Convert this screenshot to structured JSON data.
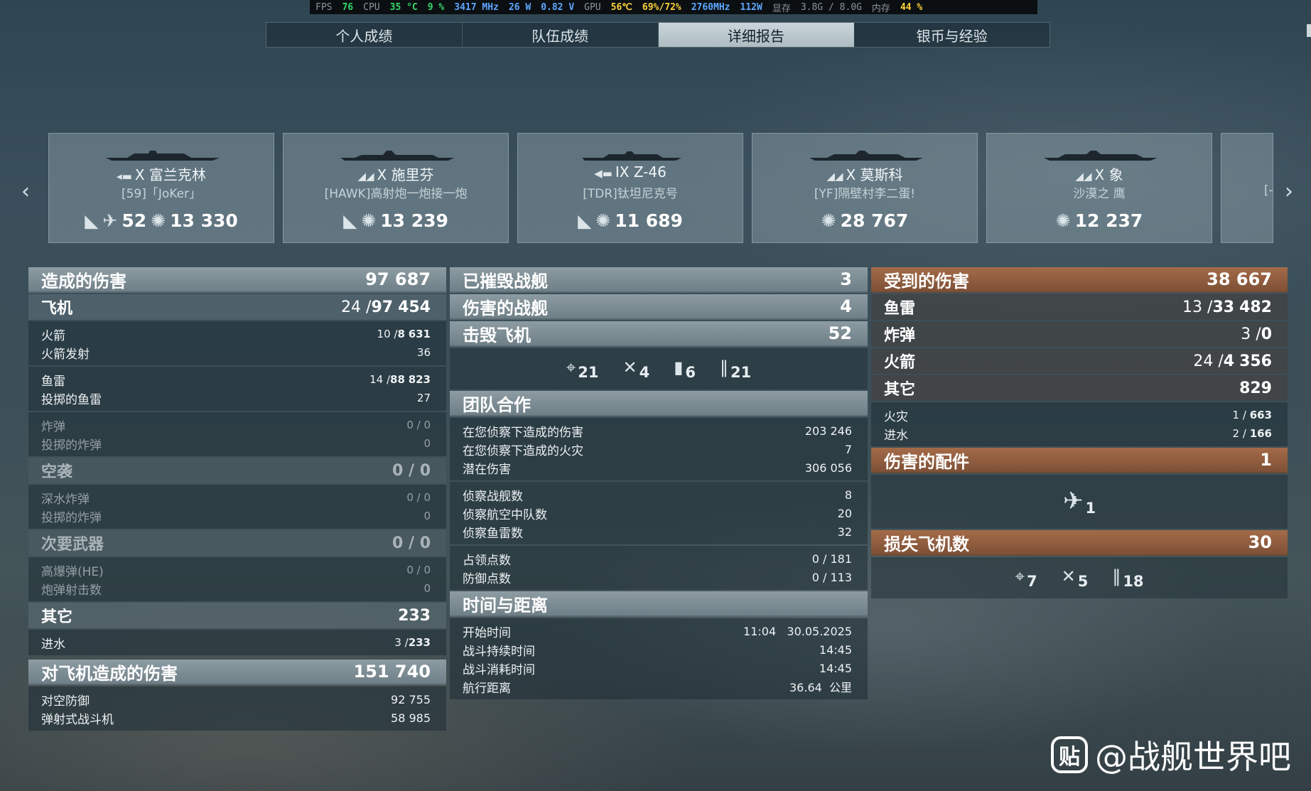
{
  "perf": {
    "fps_label": "FPS",
    "fps": "76",
    "cpu_label": "CPU",
    "cpu_temp": "35 °C",
    "cpu_load": "9 %",
    "cpu_freq": "3417 MHz",
    "cpu_power": "26 W",
    "cpu_volt": "0.82 V",
    "gpu_label": "GPU",
    "gpu_temp": "56℃",
    "gpu_load": "69%/72%",
    "gpu_freq": "2760MHz",
    "gpu_power": "112W",
    "vram_label": "显存",
    "vram": "3.8G / 8.0G",
    "ram_label": "内存",
    "ram": "44 %"
  },
  "tabs": [
    "个人成绩",
    "队伍成绩",
    "详细报告",
    "银币与经验"
  ],
  "ships": [
    {
      "tier": "X",
      "name": "富兰克林",
      "player": "[59]「JoKer」",
      "kills": "52",
      "damage": "13 330"
    },
    {
      "tier": "X",
      "name": "施里芬",
      "player": "[HAWK]高射炮一炮接一炮",
      "damage": "13 239"
    },
    {
      "tier": "IX",
      "name": "Z-46",
      "player": "[TDR]钛坦尼克号",
      "damage": "11 689"
    },
    {
      "tier": "X",
      "name": "莫斯科",
      "player": "[YF]隔壁村李二蛋!",
      "damage": "28 767"
    },
    {
      "tier": "X",
      "name": "象",
      "player": "沙漠之 鹰",
      "damage": "12 237"
    },
    {
      "player": "[-"
    }
  ],
  "left": {
    "damage_dealt": {
      "label": "造成的伤害",
      "value": "97 687"
    },
    "aircraft": {
      "label": "飞机",
      "hits": "24 /",
      "bold": "97",
      "value": "454"
    },
    "rockets": {
      "label": "火箭",
      "v1": "10 /",
      "v2": "8",
      "v3": "631"
    },
    "rockets_fired": {
      "label": "火箭发射",
      "value": "36"
    },
    "torpedoes": {
      "label": "鱼雷",
      "v1": "14 /",
      "v2": "88",
      "v3": "823"
    },
    "torpedoes_dropped": {
      "label": "投掷的鱼雷",
      "value": "27"
    },
    "bombs": {
      "label": "炸弹",
      "value": "0 / 0"
    },
    "bombs_dropped": {
      "label": "投掷的炸弹",
      "value": "0"
    },
    "airstrike": {
      "label": "空袭",
      "value": "0 / 0"
    },
    "depth_bombs": {
      "label": "深水炸弹",
      "value": "0 / 0"
    },
    "depth_dropped": {
      "label": "投掷的炸弹",
      "value": "0"
    },
    "secondary": {
      "label": "次要武器",
      "value": "0 / 0"
    },
    "he": {
      "label": "高爆弹(HE)",
      "value": "0 / 0"
    },
    "shells": {
      "label": "炮弹射击数",
      "value": "0"
    },
    "other": {
      "label": "其它",
      "value": "233"
    },
    "flooding": {
      "label": "进水",
      "v1": "3 /",
      "v2": "233"
    },
    "aa_damage": {
      "label": "对飞机造成的伤害",
      "value": "151 740"
    },
    "aa_defense": {
      "label": "对空防御",
      "value": "92 755"
    },
    "catapult": {
      "label": "弹射式战斗机",
      "value": "58 985"
    }
  },
  "middle": {
    "destroyed": {
      "label": "已摧毁战舰",
      "value": "3"
    },
    "damaged": {
      "label": "伤害的战舰",
      "value": "4"
    },
    "planes_shot": {
      "label": "击毁飞机",
      "value": "52"
    },
    "plane_icons": {
      "fighters": "21",
      "bombers": "4",
      "torpedo": "6",
      "rocket": "21"
    },
    "team": {
      "label": "团队合作"
    },
    "spot_damage": {
      "label": "在您侦察下造成的伤害",
      "value": "203 246"
    },
    "spot_fires": {
      "label": "在您侦察下造成的火灾",
      "value": "7"
    },
    "potential": {
      "label": "潜在伤害",
      "value": "306 056"
    },
    "spotted_ships": {
      "label": "侦察战舰数",
      "value": "8"
    },
    "spotted_squadrons": {
      "label": "侦察航空中队数",
      "value": "20"
    },
    "spotted_torps": {
      "label": "侦察鱼雷数",
      "value": "32"
    },
    "capture": {
      "label": "占领点数",
      "value": "0 / 181"
    },
    "defend": {
      "label": "防御点数",
      "value": "0 / 113"
    },
    "time": {
      "label": "时间与距离"
    },
    "start": {
      "label": "开始时间",
      "time": "11:04",
      "date": "30.05.2025"
    },
    "duration": {
      "label": "战斗持续时间",
      "value": "14:45"
    },
    "elapsed": {
      "label": "战斗消耗时间",
      "value": "14:45"
    },
    "distance": {
      "label": "航行距离",
      "value": "36.64",
      "unit": "公里"
    }
  },
  "right": {
    "received": {
      "label": "受到的伤害",
      "value": "38 667"
    },
    "torpedo": {
      "label": "鱼雷",
      "v1": "13 /",
      "v2": "33",
      "v3": "482"
    },
    "bomb": {
      "label": "炸弹",
      "v1": "3 /",
      "v2": "0"
    },
    "rocket": {
      "label": "火箭",
      "v1": "24 /",
      "v2": "4",
      "v3": "356"
    },
    "other": {
      "label": "其它",
      "value": "829"
    },
    "fire": {
      "label": "火灾",
      "v1": "1 /",
      "v2": "663"
    },
    "flood": {
      "label": "进水",
      "v1": "2 /",
      "v2": "166"
    },
    "modules": {
      "label": "伤害的配件",
      "value": "1"
    },
    "module_count": "1",
    "lost": {
      "label": "损失飞机数",
      "value": "30"
    },
    "lost_icons": {
      "fighters": "7",
      "bombers": "5",
      "rocket": "18"
    }
  },
  "watermark": {
    "logo": "贴",
    "text": "@战舰世界吧"
  }
}
